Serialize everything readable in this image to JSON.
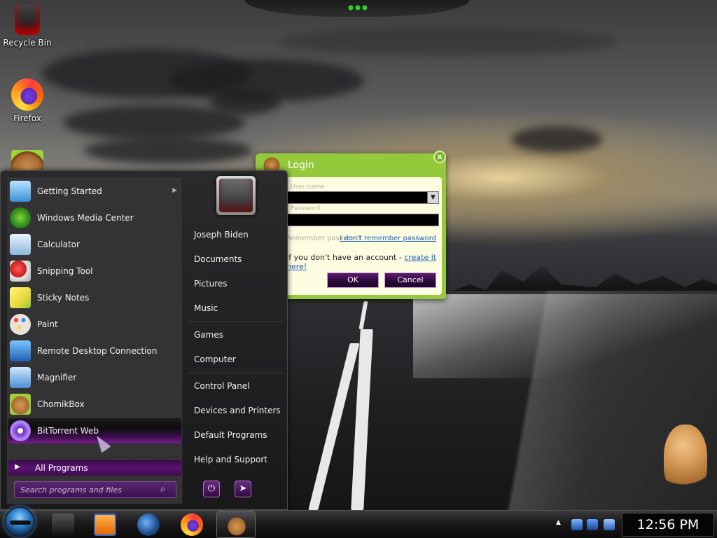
{
  "desktop": {
    "icons": [
      {
        "label": "Recycle Bin",
        "icon": "recycle-bin-icon"
      },
      {
        "label": "Firefox",
        "icon": "firefox-icon"
      },
      {
        "label": "",
        "icon": "chomikbox-icon"
      }
    ]
  },
  "login": {
    "title": "Login",
    "username_label": "User name",
    "password_label": "Password",
    "remember_label": "Remember password",
    "forgot_link": "I don't remember password",
    "account_text": "If you don't have an account - ",
    "create_link": "create it here!",
    "ok": "OK",
    "cancel": "Cancel",
    "close": "x"
  },
  "start_menu": {
    "programs": [
      {
        "label": "Getting Started",
        "icon": "getting-started-icon",
        "has_submenu": true
      },
      {
        "label": "Windows Media Center",
        "icon": "media-center-icon"
      },
      {
        "label": "Calculator",
        "icon": "calculator-icon"
      },
      {
        "label": "Snipping Tool",
        "icon": "snipping-tool-icon"
      },
      {
        "label": "Sticky Notes",
        "icon": "sticky-notes-icon"
      },
      {
        "label": "Paint",
        "icon": "paint-icon"
      },
      {
        "label": "Remote Desktop Connection",
        "icon": "remote-desktop-icon"
      },
      {
        "label": "Magnifier",
        "icon": "magnifier-icon"
      },
      {
        "label": "ChomikBox",
        "icon": "chomikbox-icon"
      },
      {
        "label": "BitTorrent Web",
        "icon": "bittorrent-icon",
        "highlighted": true
      }
    ],
    "all_programs": "All Programs",
    "search_placeholder": "Search programs and files",
    "places": [
      {
        "label": "Joseph Biden"
      },
      {
        "label": "Documents"
      },
      {
        "label": "Pictures"
      },
      {
        "label": "Music"
      },
      {
        "label": "Games"
      },
      {
        "label": "Computer"
      },
      {
        "label": "Control Panel"
      },
      {
        "label": "Devices and Printers"
      },
      {
        "label": "Default Programs"
      },
      {
        "label": "Help and Support"
      }
    ]
  },
  "taskbar": {
    "clock": "12:56 PM",
    "pinned": [
      "explorer-icon",
      "media-player-icon",
      "globe-icon",
      "firefox-icon",
      "chomikbox-icon"
    ]
  },
  "colors": {
    "accent_green": "#93c93a",
    "accent_purple": "#5b1372"
  }
}
